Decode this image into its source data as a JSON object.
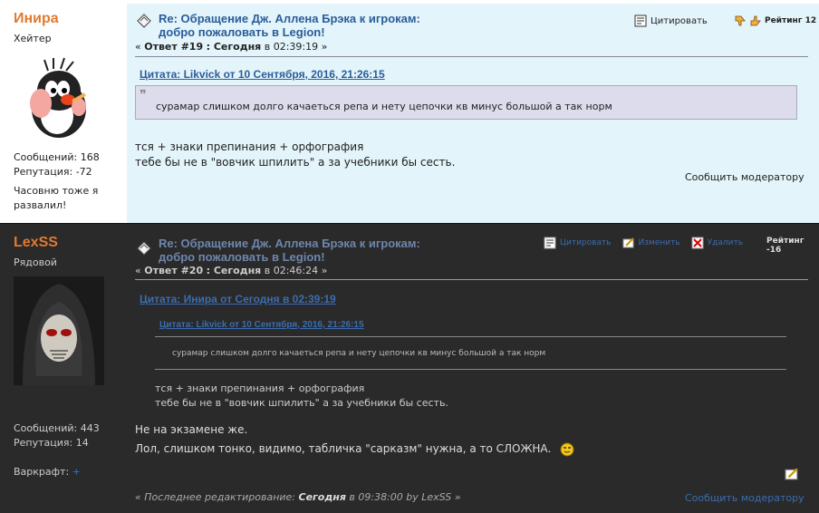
{
  "posts": [
    {
      "author": "Инира",
      "rank": "Хейтер",
      "stats": {
        "messages": "Сообщений: 168",
        "reputation": "Репутация: -72"
      },
      "signature": "Часовню тоже я развалил!",
      "title_line1": "Re: Обращение Дж. Аллена Брэка к игрокам:",
      "title_line2": "добро пожаловать в Legion!",
      "meta_prefix": "«",
      "reply_label": "Ответ #19",
      "date_label": "Сегодня",
      "time": "в 02:39:19",
      "meta_suffix": "»",
      "toolbar": {
        "quote": "Цитировать"
      },
      "rating": "Рейтинг 12",
      "quote": {
        "header": "Цитата: Likvick от 10 Сентября, 2016, 21:26:15",
        "text": "сурамар слишком долго качаеться репа и нету цепочки кв минус большой а так норм"
      },
      "body_line1": "тся + знаки препинания + орфография",
      "body_line2": "тебе бы не в \"вовчик шпилить\" а за учебники бы сесть.",
      "report": "Сообщить модератору"
    },
    {
      "author": "LexSS",
      "rank": "Рядовой",
      "stats": {
        "messages": "Сообщений: 443",
        "reputation": "Репутация: 14"
      },
      "signature_label": "Варкрафт:",
      "signature_plus": "+",
      "title_line1": "Re: Обращение Дж. Аллена Брэка к игрокам:",
      "title_line2": "добро пожаловать в Legion!",
      "meta_prefix": "«",
      "reply_label": "Ответ #20",
      "date_label": "Сегодня",
      "time": "в 02:46:24",
      "meta_suffix": "»",
      "toolbar": {
        "quote": "Цитировать",
        "edit": "Изменить",
        "delete": "Удалить"
      },
      "rating": "Рейтинг -16",
      "quote_outer": {
        "header": "Цитата: Инира от Сегодня в 02:39:19",
        "inner_header": "Цитата: Likvick от 10 Сентября, 2016, 21:26:15",
        "inner_text": "сурамар слишком долго качаеться репа и нету цепочки кв минус большой а так норм",
        "line1": "тся + знаки препинания + орфография",
        "line2": "тебе бы не в \"вовчик шпилить\" а за учебники бы сесть."
      },
      "body_line1": "Не на экзамене же.",
      "body_line2": "Лол, слишком тонко, видимо, табличка \"сарказм\" нужна, а то СЛОЖНА.",
      "edited_prefix": "« Последнее редактирование:",
      "edited_date": "Сегодня",
      "edited_suffix": "в 09:38:00 by LexSS »",
      "report": "Сообщить модератору"
    }
  ],
  "colors": {
    "author": "#e07a2e",
    "title": "#2b5d9a",
    "bg_post1": "#e3f4fa",
    "bg_post2": "#2a2a2a",
    "quote_bg": "#dcdcec"
  },
  "icons": [
    "post-icon",
    "quote-icon",
    "thumbs-down-icon",
    "thumbs-up-icon",
    "edit-icon",
    "delete-icon",
    "smiley-icon",
    "mole-avatar",
    "skull-avatar"
  ]
}
